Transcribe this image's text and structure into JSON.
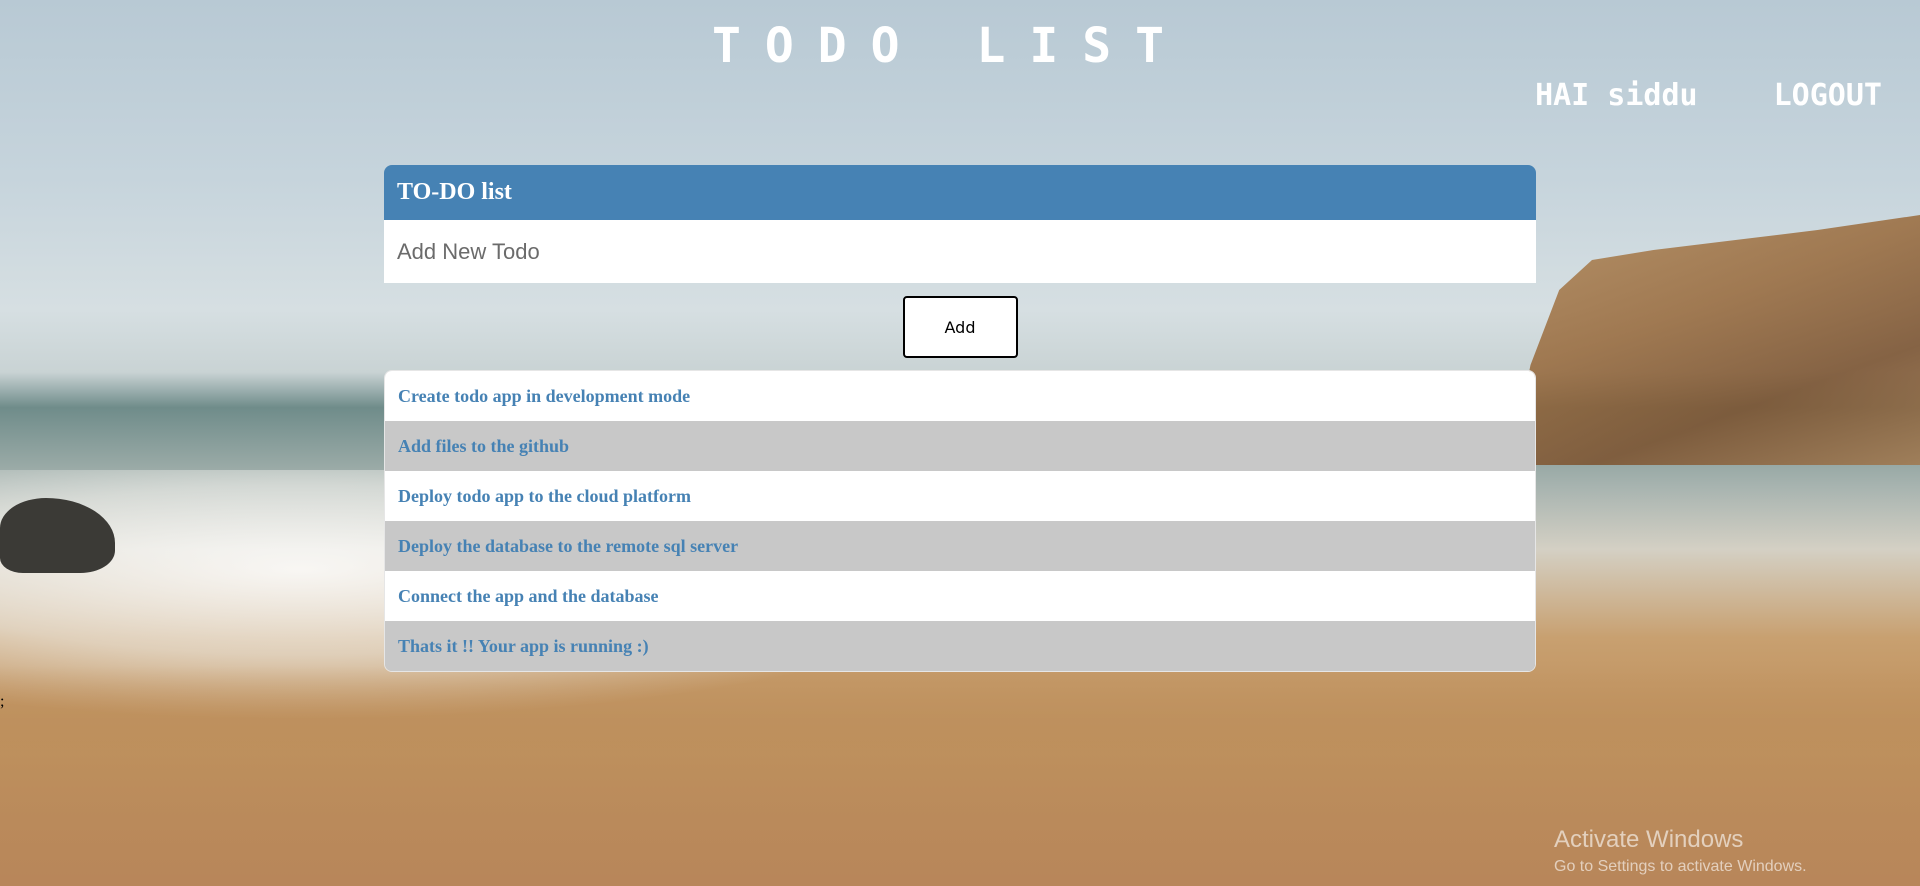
{
  "header": {
    "title": "TODO LIST",
    "greeting": "HAI siddu",
    "logout_label": "LOGOUT"
  },
  "panel": {
    "title": "TO-DO list",
    "input_placeholder": "Add New Todo",
    "input_value": "",
    "add_label": "Add"
  },
  "todos": [
    "Create todo app in development mode",
    "Add files to the github",
    "Deploy todo app to the cloud platform",
    "Deploy the database to the remote sql server",
    "Connect the app and the database",
    "Thats it !! Your app is running :)"
  ],
  "stray_text": ";",
  "watermark": {
    "title": "Activate Windows",
    "subtitle": "Go to Settings to activate Windows."
  },
  "colors": {
    "accent": "#4682b4",
    "item_text": "#4682b4",
    "alt_row": "#c8c8c8"
  }
}
